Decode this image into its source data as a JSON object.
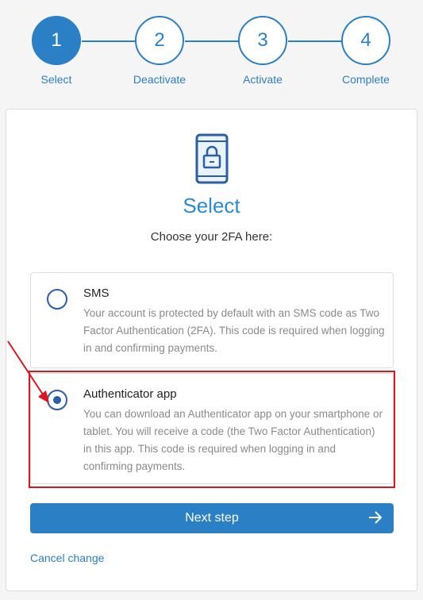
{
  "stepper": {
    "steps": [
      {
        "number": "1",
        "label": "Select",
        "active": true
      },
      {
        "number": "2",
        "label": "Deactivate",
        "active": false
      },
      {
        "number": "3",
        "label": "Activate",
        "active": false
      },
      {
        "number": "4",
        "label": "Complete",
        "active": false
      }
    ]
  },
  "card": {
    "icon": "phone-lock-icon",
    "title": "Select",
    "subtitle": "Choose your 2FA here:",
    "options": [
      {
        "title": "SMS",
        "description": "Your account is protected by default with an SMS code as Two Factor Authentication (2FA). This code is required when logging in and confirming payments.",
        "selected": false
      },
      {
        "title": "Authenticator app",
        "description": "You can download an Authenticator app on your smartphone or tablet. You will receive a code (the Two Factor Authentication) in this app. This code is required when logging in and confirming payments.",
        "selected": true
      }
    ],
    "next_button": "Next step",
    "next_icon": "arrow-right-icon",
    "cancel_link": "Cancel change"
  },
  "colors": {
    "primary": "#2a7fc5",
    "highlight": "#e0141e"
  }
}
